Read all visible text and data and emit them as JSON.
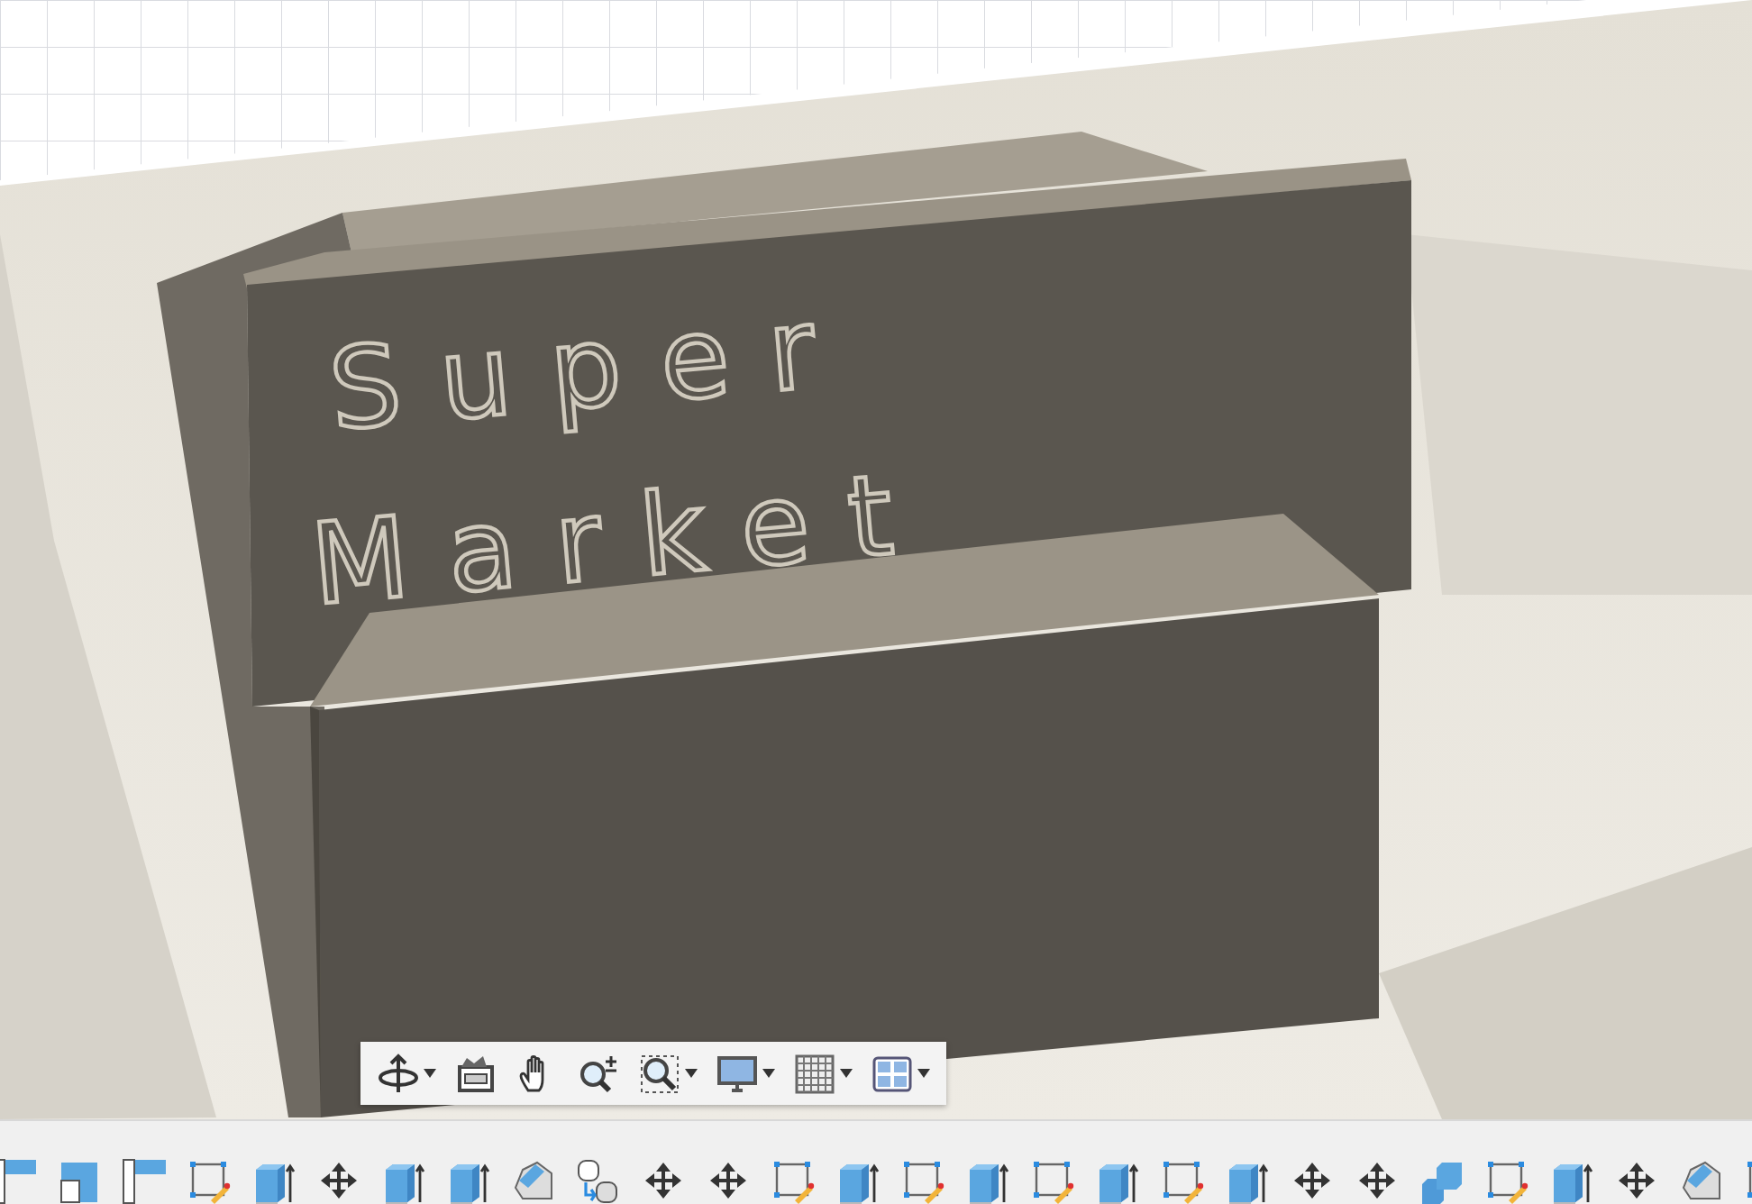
{
  "viewport": {
    "model_text": [
      "Super",
      "Market"
    ]
  },
  "navigation_toolbar": [
    {
      "kind": "orbit",
      "dropdown": true
    },
    {
      "kind": "look-at",
      "dropdown": false
    },
    {
      "kind": "pan",
      "dropdown": false
    },
    {
      "kind": "zoom",
      "dropdown": false
    },
    {
      "kind": "fit",
      "dropdown": true
    },
    {
      "kind": "display",
      "dropdown": true
    },
    {
      "kind": "grid",
      "dropdown": true
    },
    {
      "kind": "viewports",
      "dropdown": true
    }
  ],
  "toolbar": [
    {
      "kind": "corner"
    },
    {
      "kind": "frame"
    },
    {
      "kind": "corner"
    },
    {
      "kind": "sketch"
    },
    {
      "kind": "extrude"
    },
    {
      "kind": "move"
    },
    {
      "kind": "extrude"
    },
    {
      "kind": "extrude"
    },
    {
      "kind": "presspull"
    },
    {
      "kind": "joint"
    },
    {
      "kind": "move"
    },
    {
      "kind": "move"
    },
    {
      "kind": "sketch"
    },
    {
      "kind": "extrude"
    },
    {
      "kind": "sketch"
    },
    {
      "kind": "extrude"
    },
    {
      "kind": "sketch"
    },
    {
      "kind": "extrude"
    },
    {
      "kind": "sketch"
    },
    {
      "kind": "extrude"
    },
    {
      "kind": "move"
    },
    {
      "kind": "move"
    },
    {
      "kind": "combine"
    },
    {
      "kind": "sketch"
    },
    {
      "kind": "extrude"
    },
    {
      "kind": "move"
    },
    {
      "kind": "presspull"
    },
    {
      "kind": "sketch"
    }
  ]
}
